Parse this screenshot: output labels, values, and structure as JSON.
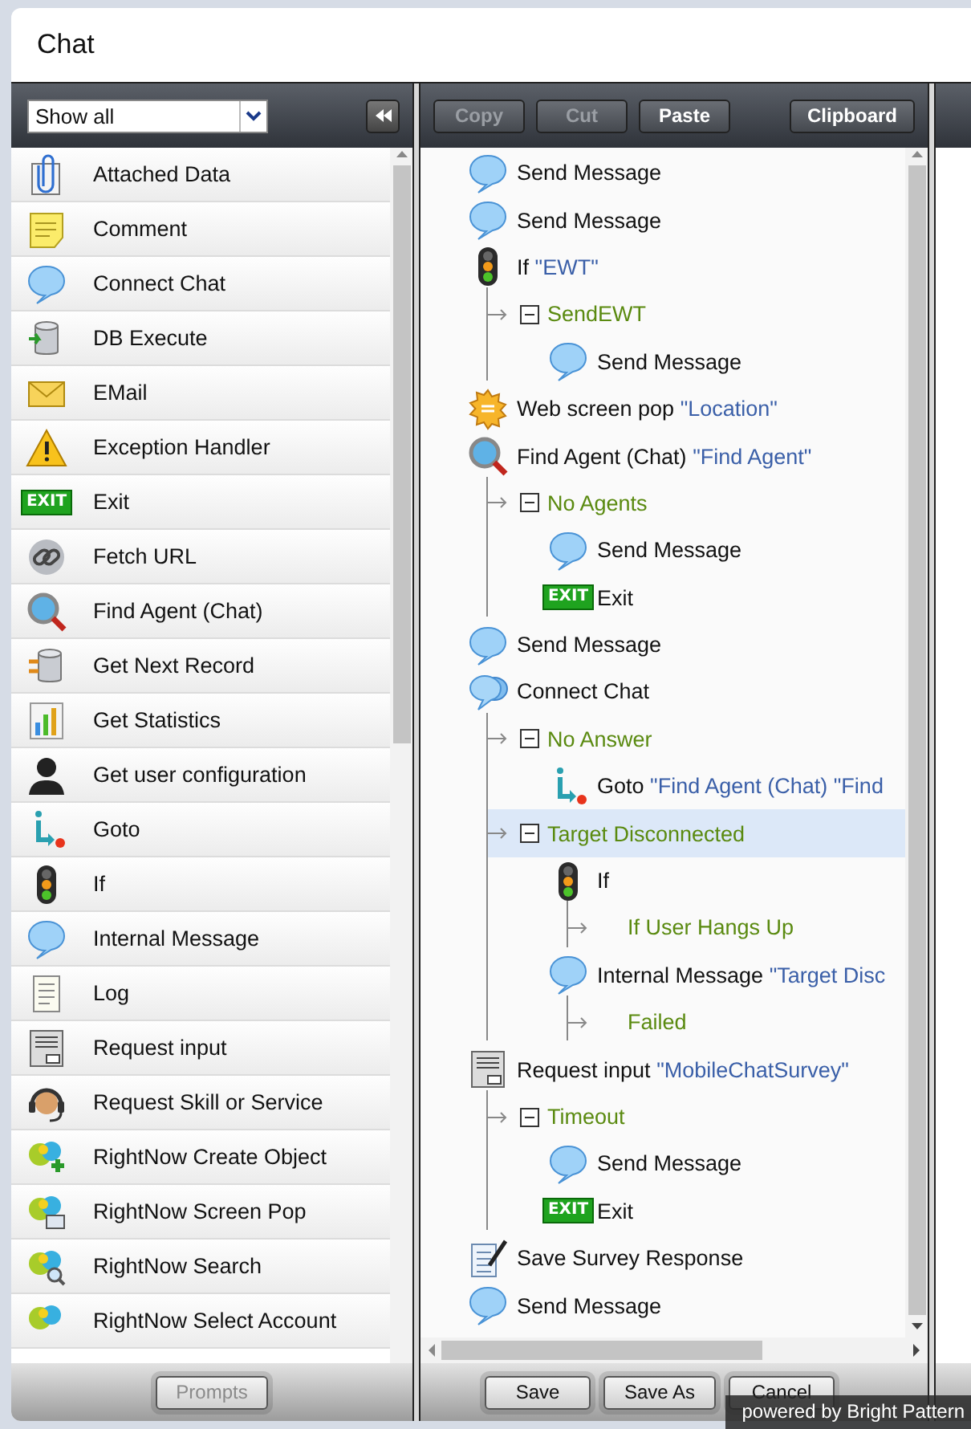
{
  "window": {
    "title": "Chat"
  },
  "palette": {
    "filter": {
      "value": "Show all"
    },
    "items": [
      {
        "label": "Attached Data",
        "kind": "clip"
      },
      {
        "label": "Comment",
        "kind": "note"
      },
      {
        "label": "Connect Chat",
        "kind": "bubble"
      },
      {
        "label": "DB Execute",
        "kind": "database"
      },
      {
        "label": "EMail",
        "kind": "mail"
      },
      {
        "label": "Exception Handler",
        "kind": "warning"
      },
      {
        "label": "Exit",
        "kind": "exit",
        "sign": "EXIT"
      },
      {
        "label": "Fetch URL",
        "kind": "link"
      },
      {
        "label": "Find Agent (Chat)",
        "kind": "magnifier"
      },
      {
        "label": "Get Next Record",
        "kind": "records"
      },
      {
        "label": "Get Statistics",
        "kind": "chart"
      },
      {
        "label": "Get user configuration",
        "kind": "person"
      },
      {
        "label": "Goto",
        "kind": "goto"
      },
      {
        "label": "If",
        "kind": "traffic"
      },
      {
        "label": "Internal Message",
        "kind": "bubble"
      },
      {
        "label": "Log",
        "kind": "log"
      },
      {
        "label": "Request input",
        "kind": "form"
      },
      {
        "label": "Request Skill or Service",
        "kind": "headset"
      },
      {
        "label": "RightNow Create Object",
        "kind": "rnplus"
      },
      {
        "label": "RightNow Screen Pop",
        "kind": "rnscreen"
      },
      {
        "label": "RightNow Search",
        "kind": "rnsearch"
      },
      {
        "label": "RightNow Select Account",
        "kind": "rnselect"
      }
    ]
  },
  "toolbar": {
    "buttons": [
      {
        "label": "Copy",
        "disabled": true
      },
      {
        "label": "Cut",
        "disabled": true
      },
      {
        "label": "Paste",
        "disabled": false
      },
      {
        "label": "Clipboard",
        "disabled": false
      }
    ]
  },
  "flow": [
    {
      "kind": "bubble",
      "name": "Send Message"
    },
    {
      "kind": "bubble",
      "name": "Send Message"
    },
    {
      "kind": "traffic",
      "name": "If",
      "param": "\"EWT\"",
      "branches": [
        {
          "label": "SendEWT",
          "expanded": true,
          "selected": false,
          "children": [
            {
              "kind": "bubble",
              "name": "Send Message"
            }
          ]
        }
      ]
    },
    {
      "kind": "sun",
      "name": "Web screen pop",
      "param": "\"Location\""
    },
    {
      "kind": "magnifier",
      "name": "Find Agent (Chat)",
      "param": "\"Find Agent\"",
      "branches": [
        {
          "label": "No Agents",
          "expanded": true,
          "selected": false,
          "children": [
            {
              "kind": "bubble",
              "name": "Send Message"
            },
            {
              "kind": "exit",
              "sign": "EXIT",
              "name": "Exit"
            }
          ]
        }
      ]
    },
    {
      "kind": "bubble",
      "name": "Send Message"
    },
    {
      "kind": "double",
      "name": "Connect Chat",
      "branches": [
        {
          "label": "No Answer",
          "expanded": true,
          "selected": false,
          "children": [
            {
              "kind": "goto",
              "name": "Goto",
              "param": "\"Find Agent (Chat) \"Find"
            }
          ]
        },
        {
          "label": "Target Disconnected",
          "expanded": true,
          "selected": true,
          "children": [
            {
              "kind": "traffic",
              "name": "If",
              "branches": [
                {
                  "label": "If User Hangs Up",
                  "selected": false
                }
              ]
            },
            {
              "kind": "bubble",
              "name": "Internal Message",
              "param": "\"Target Disc",
              "branches": [
                {
                  "label": "Failed",
                  "selected": false
                }
              ]
            }
          ]
        }
      ]
    },
    {
      "kind": "form",
      "name": "Request input",
      "param": "\"MobileChatSurvey\"",
      "branches": [
        {
          "label": "Timeout",
          "expanded": true,
          "selected": false,
          "children": [
            {
              "kind": "bubble",
              "name": "Send Message"
            },
            {
              "kind": "exit",
              "sign": "EXIT",
              "name": "Exit"
            }
          ]
        }
      ]
    },
    {
      "kind": "pencil",
      "name": "Save Survey Response"
    },
    {
      "kind": "bubble",
      "name": "Send Message"
    }
  ],
  "footer": {
    "left_buttons": [
      {
        "label": "Prompts",
        "disabled": true
      }
    ],
    "buttons": [
      {
        "label": "Save",
        "disabled": false
      },
      {
        "label": "Save As",
        "disabled": false
      },
      {
        "label": "Cancel",
        "disabled": false
      }
    ]
  },
  "badge": "powered by Bright Pattern"
}
